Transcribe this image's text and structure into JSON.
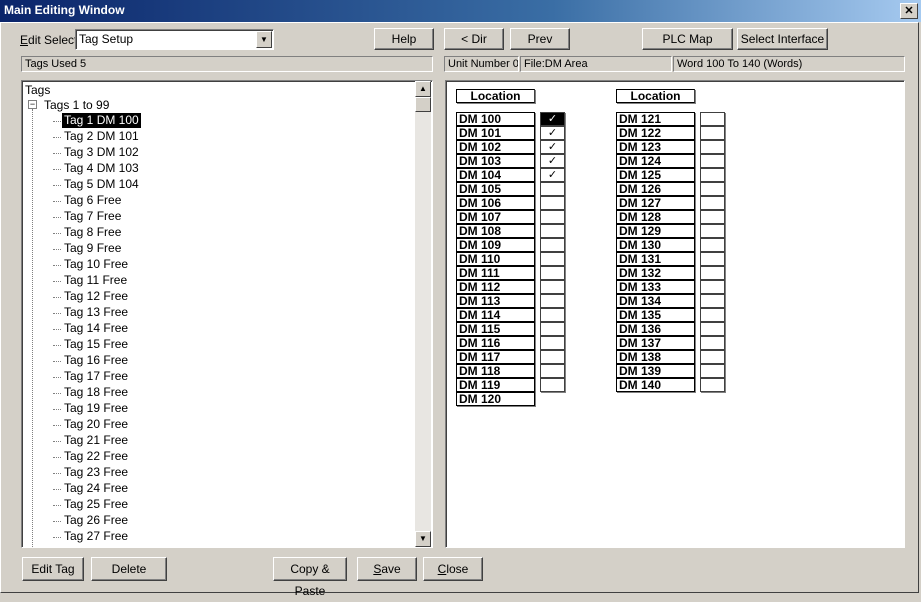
{
  "window": {
    "title": "Main Editing Window",
    "close_glyph": "✕"
  },
  "toolbar": {
    "edit_select_label_prefix": "E",
    "edit_select_label_rest": "dit Select",
    "edit_select_value": "Tag Setup",
    "help": "Help",
    "dir": "< Dir",
    "prev": "Prev",
    "plc_map": "PLC Map",
    "select_interface": "Select Interface"
  },
  "status": {
    "tags_used": "Tags Used 5",
    "unit_number": "Unit Number 0",
    "file": "File:DM Area",
    "word_range": "Word 100 To 140 (Words)"
  },
  "tree": {
    "root": "Tags",
    "group": "Tags 1 to 99",
    "expander": "−",
    "selected_index": 0,
    "items": [
      "Tag 1 DM 100",
      "Tag 2 DM 101",
      "Tag 3 DM 102",
      "Tag 4 DM 103",
      "Tag 5 DM 104",
      "Tag 6 Free",
      "Tag 7 Free",
      "Tag 8 Free",
      "Tag 9 Free",
      "Tag 10 Free",
      "Tag 11 Free",
      "Tag 12 Free",
      "Tag 13 Free",
      "Tag 14 Free",
      "Tag 15 Free",
      "Tag 16 Free",
      "Tag 17 Free",
      "Tag 18 Free",
      "Tag 19 Free",
      "Tag 20 Free",
      "Tag 21 Free",
      "Tag 22 Free",
      "Tag 23 Free",
      "Tag 24 Free",
      "Tag 25 Free",
      "Tag 26 Free",
      "Tag 27 Free"
    ]
  },
  "map": {
    "column_header": "Location",
    "check_glyph": "✓",
    "columns": [
      {
        "locations": [
          "DM 100",
          "DM 101",
          "DM 102",
          "DM 103",
          "DM 104",
          "DM 105",
          "DM 106",
          "DM 107",
          "DM 108",
          "DM 109",
          "DM 110",
          "DM 111",
          "DM 112",
          "DM 113",
          "DM 114",
          "DM 115",
          "DM 116",
          "DM 117",
          "DM 118",
          "DM 119",
          "DM 120"
        ],
        "checked": [
          true,
          true,
          true,
          true,
          true,
          false,
          false,
          false,
          false,
          false,
          false,
          false,
          false,
          false,
          false,
          false,
          false,
          false,
          false,
          false
        ],
        "selected_index": 0
      },
      {
        "locations": [
          "DM 121",
          "DM 122",
          "DM 123",
          "DM 124",
          "DM 125",
          "DM 126",
          "DM 127",
          "DM 128",
          "DM 129",
          "DM 130",
          "DM 131",
          "DM 132",
          "DM 133",
          "DM 134",
          "DM 135",
          "DM 136",
          "DM 137",
          "DM 138",
          "DM 139",
          "DM 140"
        ],
        "checked": [
          false,
          false,
          false,
          false,
          false,
          false,
          false,
          false,
          false,
          false,
          false,
          false,
          false,
          false,
          false,
          false,
          false,
          false,
          false,
          false
        ],
        "selected_index": -1
      }
    ]
  },
  "bottom": {
    "edit_tag": "Edit Tag",
    "delete": "Delete",
    "copy_paste": "Copy & Paste",
    "save_u": "S",
    "save_rest": "ave",
    "close_u": "C",
    "close_rest": "lose"
  }
}
